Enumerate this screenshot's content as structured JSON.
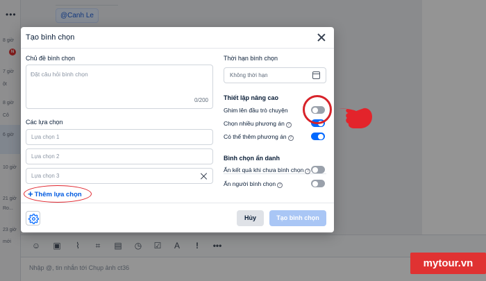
{
  "background": {
    "mention": "@Canh Le",
    "left_items": [
      "8 giờ",
      "7 giờ",
      "8 giờ",
      "6 giờ",
      "10 giờ",
      "21 giờ",
      "23 giờ"
    ],
    "left_snippets": [
      "ột",
      "Cô",
      "Ro...",
      "mới"
    ],
    "left_badge": "N",
    "message_placeholder": "Nhập @, tin nhắn tới Chụp ảnh ct36",
    "toolbar_icons": [
      "sticker-icon",
      "image-icon",
      "attach-icon",
      "screenshot-icon",
      "contact-card-icon",
      "reminder-icon",
      "task-icon",
      "text-format-icon",
      "urgent-icon",
      "more-icon"
    ]
  },
  "modal": {
    "title": "Tạo bình chọn",
    "topic_label": "Chủ đề bình chọn",
    "topic_placeholder": "Đặt câu hỏi bình chọn",
    "topic_counter": "0/200",
    "options_label": "Các lựa chọn",
    "options": [
      {
        "placeholder": "Lựa chọn 1"
      },
      {
        "placeholder": "Lựa chọn 2"
      },
      {
        "placeholder": "Lựa chọn 3"
      }
    ],
    "add_option": "Thêm lựa chọn",
    "deadline_label": "Thời hạn bình chọn",
    "deadline_value": "Không thời hạn",
    "advanced_label": "Thiết lập nâng cao",
    "advanced": [
      {
        "label": "Ghim lên đầu trò chuyện",
        "on": false,
        "info": false
      },
      {
        "label": "Chọn nhiều phương án",
        "on": true,
        "info": true
      },
      {
        "label": "Có thể thêm phương án",
        "on": true,
        "info": true
      }
    ],
    "anonymous_label": "Bình chọn ẩn danh",
    "anonymous": [
      {
        "label": "Ẩn kết quả khi chưa bình chọn",
        "on": false,
        "info": true
      },
      {
        "label": "Ẩn người bình chọn",
        "on": false,
        "info": true
      }
    ],
    "cancel": "Hủy",
    "create": "Tạo bình chọn"
  },
  "watermark": "mytour.vn",
  "colors": {
    "accent": "#0068ff",
    "toggle_off": "#9aa1ab",
    "create_disabled": "#a9c6f5",
    "annotation_red": "#d8232a",
    "watermark_bg": "#e03232"
  }
}
